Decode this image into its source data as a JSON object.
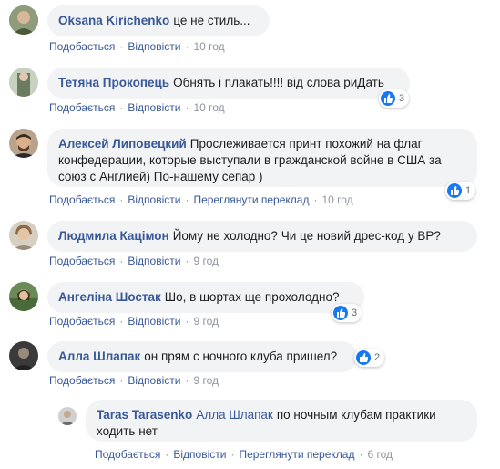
{
  "actions": {
    "like": "Подобається",
    "reply": "Відповісти",
    "see_translation": "Переглянути переклад",
    "dot": "·"
  },
  "comments": [
    {
      "author": "Oksana Kirichenko",
      "text": "це не стиль...",
      "time": "10 год"
    },
    {
      "author": "Тетяна Прокопець",
      "text": "Обнять і плакать!!!! від слова риДать",
      "time": "10 год",
      "reactions": "3"
    },
    {
      "author": "Алексей Липовецкий",
      "text": "Прослеживается принт похожий на флаг конфедерации, которые выступали в гражданской войне в США за союз с Англией) По-нашему сепар )",
      "time": "10 год",
      "reactions": "1"
    },
    {
      "author": "Людмила Кацімон",
      "text": "Йому не холодно? Чи це новий дрес-код у ВР?",
      "time": "9 год"
    },
    {
      "author": "Ангеліна Шостак",
      "text": "Шо, в шортах ще прохолодно?",
      "time": "9 год",
      "reactions": "3"
    },
    {
      "author": "Алла Шлапак",
      "text": "он прям с ночного клуба пришел?",
      "time": "9 год",
      "reactions": "2"
    }
  ],
  "reply": {
    "author": "Taras Tarasenko",
    "mention": "Алла Шлапак",
    "text": "по ночным клубам практики ходить нет",
    "time": "6 год"
  },
  "colors": {
    "link": "#385898",
    "bubble": "#f2f3f5",
    "like": "#1877f2"
  }
}
